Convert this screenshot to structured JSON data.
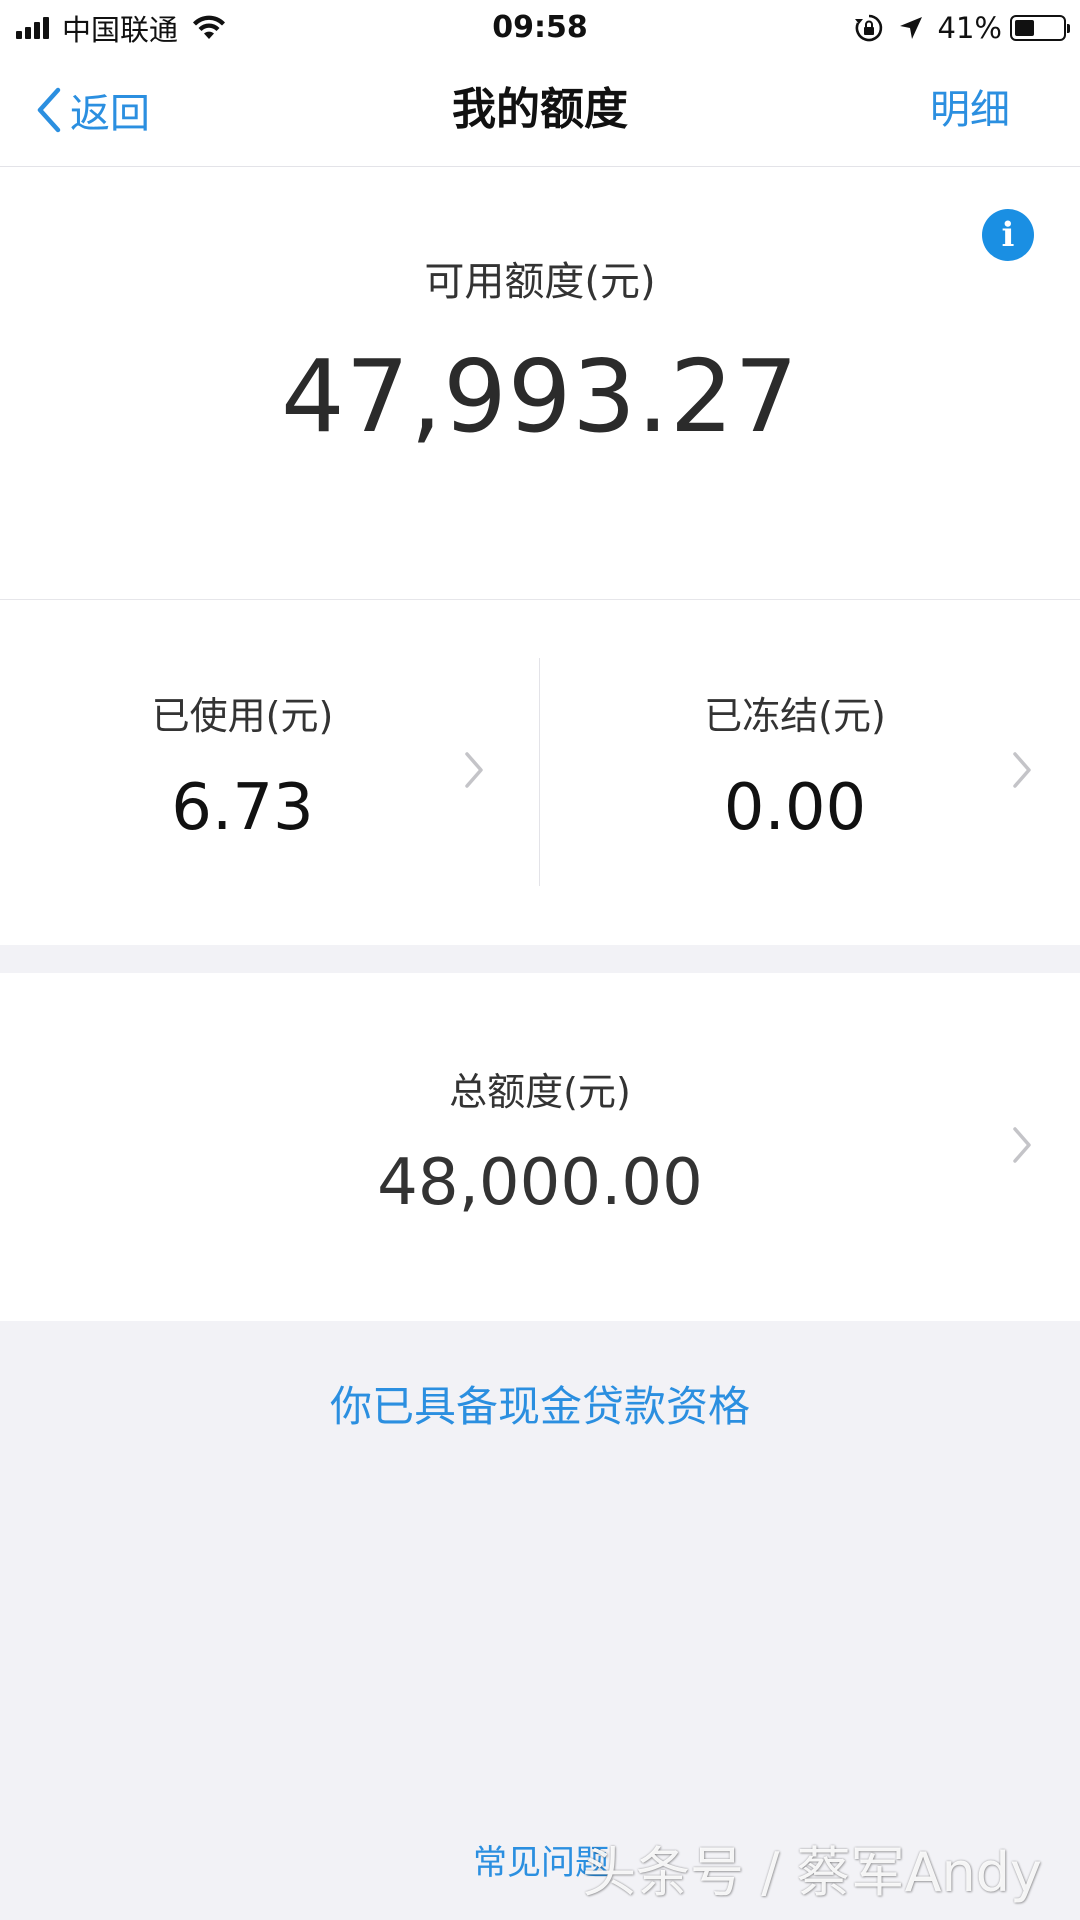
{
  "status_bar": {
    "carrier": "中国联通",
    "time": "09:58",
    "battery_percent": "41%",
    "battery_level": 0.41,
    "icons": [
      "signal-icon",
      "wifi-icon",
      "rotation-lock-icon",
      "location-icon",
      "battery-icon"
    ]
  },
  "nav": {
    "back_label": "返回",
    "title": "我的额度",
    "detail_label": "明细"
  },
  "available": {
    "label": "可用额度(元)",
    "value": "47,993.27",
    "info_icon_glyph": "i"
  },
  "used": {
    "label": "已使用(元)",
    "value": "6.73"
  },
  "frozen": {
    "label": "已冻结(元)",
    "value": "0.00"
  },
  "total": {
    "label": "总额度(元)",
    "value": "48,000.00"
  },
  "cash_loan_link": "你已具备现金贷款资格",
  "faq_link": "常见问题",
  "watermark": "头条号 / 蔡军Andy",
  "colors": {
    "accent_blue": "#2b8fe0",
    "info_blue": "#1a8fe3",
    "page_bg": "#f2f2f6",
    "card_bg": "#ffffff"
  }
}
